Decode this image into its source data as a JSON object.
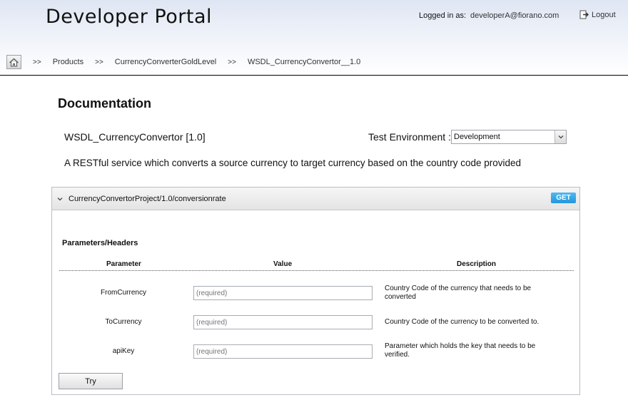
{
  "header": {
    "title": "Developer Portal",
    "logged_in_label": "Logged in as:",
    "user": "developerA@fiorano.com",
    "logout_label": "Logout"
  },
  "breadcrumb": {
    "separator": ">>",
    "items": [
      {
        "label": "Products"
      },
      {
        "label": "CurrencyConverterGoldLevel"
      },
      {
        "label": "WSDL_CurrencyConvertor__1.0"
      }
    ]
  },
  "main": {
    "heading": "Documentation",
    "api_name": "WSDL_CurrencyConvertor [1.0]",
    "env_label": "Test Environment :",
    "env_value": "Development",
    "description": "A RESTful service which converts a source currency to target currency based on the country code provided"
  },
  "endpoint": {
    "path": "CurrencyConvertorProject/1.0/conversionrate",
    "method": "GET",
    "method_color": "#2b9fe2"
  },
  "params": {
    "title": "Parameters/Headers",
    "columns": {
      "parameter": "Parameter",
      "value": "Value",
      "description": "Description"
    },
    "rows": [
      {
        "name": "FromCurrency",
        "placeholder": "(required)",
        "description": "Country Code of the currency that needs to be converted"
      },
      {
        "name": "ToCurrency",
        "placeholder": "(required)",
        "description": "Country Code of the currency to be converted to."
      },
      {
        "name": "apiKey",
        "placeholder": "(required)",
        "description": "Parameter which holds the key that needs to be verified."
      }
    ],
    "try_label": "Try"
  }
}
